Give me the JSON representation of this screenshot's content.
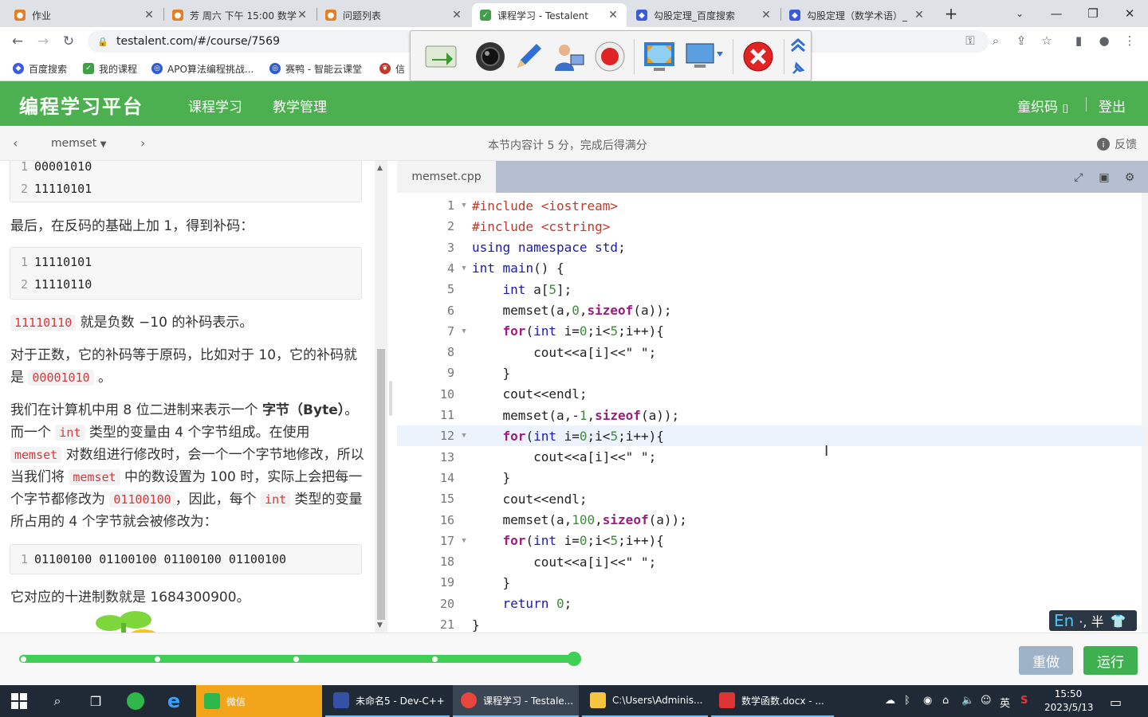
{
  "browser": {
    "tabs": [
      {
        "title": "作业",
        "active": false
      },
      {
        "title": "芳 周六 下午 15:00 数学",
        "active": false
      },
      {
        "title": "问题列表",
        "active": false
      },
      {
        "title": "课程学习 - Testalent",
        "active": true
      },
      {
        "title": "勾股定理_百度搜索",
        "active": false
      },
      {
        "title": "勾股定理（数学术语）_",
        "active": false
      }
    ],
    "new_tab": "+",
    "url": "testalent.com/#/course/7569",
    "bookmarks": [
      "百度搜索",
      "我的课程",
      "APO算法编程挑战...",
      "赛鸭 - 智能云课堂",
      "信"
    ]
  },
  "site": {
    "logo": "编程学习平台",
    "nav": [
      "课程学习",
      "教学管理"
    ],
    "user": "童织码",
    "logout": "登出"
  },
  "subheader": {
    "selector": "memset",
    "info": "本节内容计 5 分，完成后得满分",
    "feedback": "反馈"
  },
  "lesson": {
    "block1": [
      "00001010",
      "11110101"
    ],
    "p1": "最后，在反码的基础上加 1，得到补码：",
    "block2": [
      "11110101",
      "11110110"
    ],
    "p2_code": "11110110",
    "p2_text": " 就是负数 −10 的补码表示。",
    "p3_text": "对于正数，它的补码等于原码，比如对于 10，它的补码就是 ",
    "p3_code": "00001010",
    "p3_end": " 。",
    "p4_a": "我们在计算机中用 8 位二进制来表示一个 ",
    "p4_b": "字节",
    "p4_c": "（Byte）",
    "p4_d": "。而一个 ",
    "p4_code1": "int",
    "p4_e": " 类型的变量由 4 个字节组成。在使用 ",
    "p4_code2": "memset",
    "p4_f": " 对数组进行修改时，会一个一个字节地修改，所以当我们将 ",
    "p4_code3": "memset",
    "p4_g": " 中的数设置为 100 时，实际上会把每一个字节都修改为 ",
    "p4_code4": "01100100",
    "p4_h": "，因此，每个 ",
    "p4_code5": "int",
    "p4_i": " 类型的变量所占用的 4 个字节就会被修改为：",
    "block3": [
      "01100100 01100100 01100100 01100100"
    ],
    "p5": "它对应的十进制数就是 1684300900。"
  },
  "editor": {
    "filename": "memset.cpp",
    "current_line": 12,
    "lines": [
      "#include <iostream>",
      "#include <cstring>",
      "using namespace std;",
      "int main() {",
      "    int a[5];",
      "    memset(a,0,sizeof(a));",
      "    for(int i=0;i<5;i++){",
      "        cout<<a[i]<<\" \";",
      "    }",
      "    cout<<endl;",
      "    memset(a,-1,sizeof(a));",
      "    for(int i=0;i<5;i++){",
      "        cout<<a[i]<<\" \";",
      "    }",
      "    cout<<endl;",
      "    memset(a,100,sizeof(a));",
      "    for(int i=0;i<5;i++){",
      "        cout<<a[i]<<\" \";",
      "    }",
      "    return 0;",
      "}"
    ]
  },
  "ime": {
    "lang": "En",
    "rest": "·, 半"
  },
  "bottom": {
    "progress_percent": 100,
    "redo": "重做",
    "run": "运行"
  },
  "taskbar": {
    "apps": [
      "微信",
      "未命名5 - Dev-C++",
      "课程学习 - Testale...",
      "C:\\Users\\Adminis...",
      "数学函数.docx - ..."
    ],
    "ime_tray": "英",
    "time": "15:50",
    "date": "2023/5/13"
  },
  "colors": {
    "brand": "#4caf50",
    "accent_red": "#d9383a",
    "redo_btn": "#9fb3c8",
    "run_btn": "#3fb04f"
  }
}
